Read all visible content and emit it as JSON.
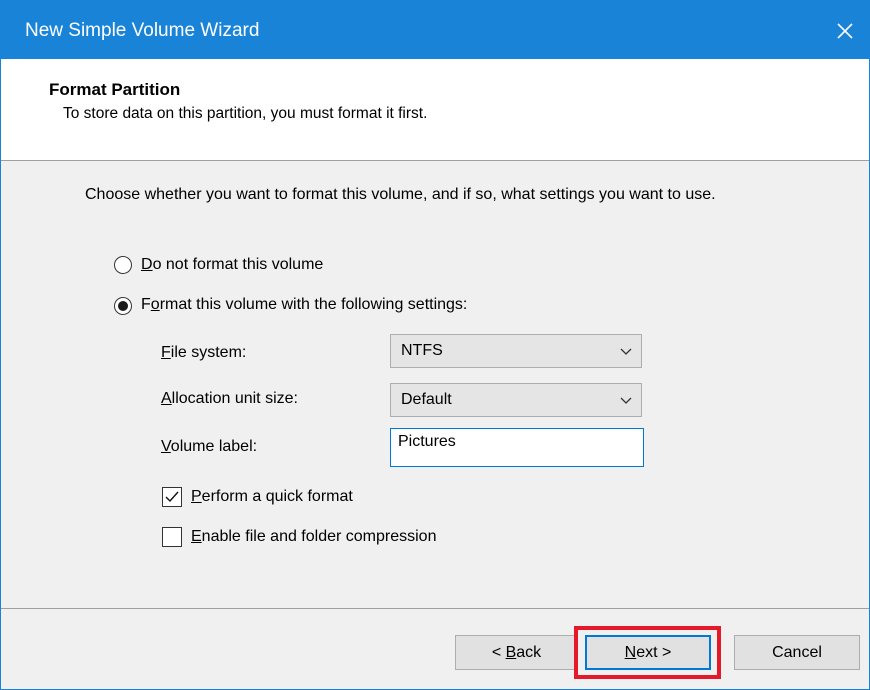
{
  "window": {
    "title": "New Simple Volume Wizard",
    "accent_color": "#1883d7",
    "close_icon": "close-icon"
  },
  "header": {
    "title": "Format Partition",
    "subtitle": "To store data on this partition, you must format it first."
  },
  "main": {
    "instruction": "Choose whether you want to format this volume, and if so, what settings you want to use.",
    "options": [
      {
        "label_accel": "D",
        "label_rest": "o not format this volume",
        "selected": false
      },
      {
        "label_accel": "o",
        "label_pre": "F",
        "label_rest": "rmat this volume with the following settings:",
        "selected": true
      }
    ],
    "file_system": {
      "label_accel": "F",
      "label_rest": "ile system:",
      "value": "NTFS"
    },
    "allocation": {
      "label_accel": "A",
      "label_rest": "llocation unit size:",
      "value": "Default"
    },
    "volume_label": {
      "label_accel": "V",
      "label_rest": "olume label:",
      "value": "Pictures"
    },
    "quick_format": {
      "label_accel": "P",
      "label_rest": "erform a quick format",
      "checked": true
    },
    "compression": {
      "label_accel": "E",
      "label_rest": "nable file and folder compression",
      "checked": false
    }
  },
  "footer": {
    "back": {
      "prefix": "< ",
      "accel": "B",
      "rest": "ack"
    },
    "next": {
      "accel": "N",
      "rest": "ext >"
    },
    "cancel": "Cancel",
    "highlight_color": "#e5192a"
  }
}
